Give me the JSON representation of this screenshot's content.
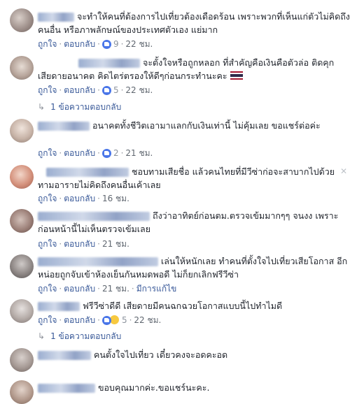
{
  "labels": {
    "like": "ถูกใจ",
    "reply": "ตอบกลับ",
    "edited": "มีการแก้ไข"
  },
  "colors": {
    "link": "#385898",
    "meta": "#606770",
    "like_badge": "#4a76e8",
    "sad_badge": "#f7c940"
  },
  "comments": [
    {
      "text": "จะทำให้คนที่ต้องการไปเที่ยวต้องเดือดร้อน เพราะพวกที่เห็นแก่ตัวไม่คิดถึงคนอื่น หรือภาพลักษณ์ของประเทศตัวเอง แย่มาก",
      "count": "9",
      "time": "22 ชม."
    },
    {
      "text": "จะตั้งใจหรือถูกหลอก ที่สำคัญคือเงินคือตัวล่อ ติดคุก เสียดายอนาคต คิดไตร่ตรองให้ดีๆก่อนกระทำนะคะ",
      "flag_icon": "thai-flag",
      "count": "5",
      "time": "22 ชม.",
      "replies": "1 ข้อความตอบกลับ"
    },
    {
      "text": "อนาคตทั้งชีวิตเอามาแลกกับเงินเท่านี้ ไม่คุ้มเลย ขอแชร์ต่อค่ะ",
      "count": "2",
      "time": "21 ชม."
    },
    {
      "text": "ชอบทามเสียชื่อ แล้วคนไทยที่มีวีซ่าก่อจะสาบากไปด้วย ทามอารายไม่คิดถึงคนอื่นเค้าเลย",
      "time": "16 ชม."
    },
    {
      "text": "ถึงว่าอาทิตย์ก่อนตม.ตรวจเข้มมากๆๆ จนงง เพราะก่อนหน้านี้ไม่เห็นตรวจเข้มเลย",
      "time": "21 ชม."
    },
    {
      "text": "เล่นให้หนักเลย ทำคนที่ตั้งใจไปเที่ยวเสียโอกาส อีกหน่อยถูกจับเข้าห้องเย็นกันหมดพอดี ไม่ก็ยกเลิกฟรีวีซ่า",
      "time": "21 ชม."
    },
    {
      "text": "ฟรีวีซ่าดีดี เสียดายมีคนฉกฉวยโอกาสแบบนี้ไปทำไมดี",
      "count": "5",
      "time": "22 ชม.",
      "replies": "1 ข้อความตอบกลับ"
    },
    {
      "text": "คนตั้งใจไปเที่ยว เดี๋ยวคงจะอดคะอด"
    },
    {
      "text": "ขอบคุณมากค่ะ.ขอแชร์นะคะ."
    }
  ]
}
